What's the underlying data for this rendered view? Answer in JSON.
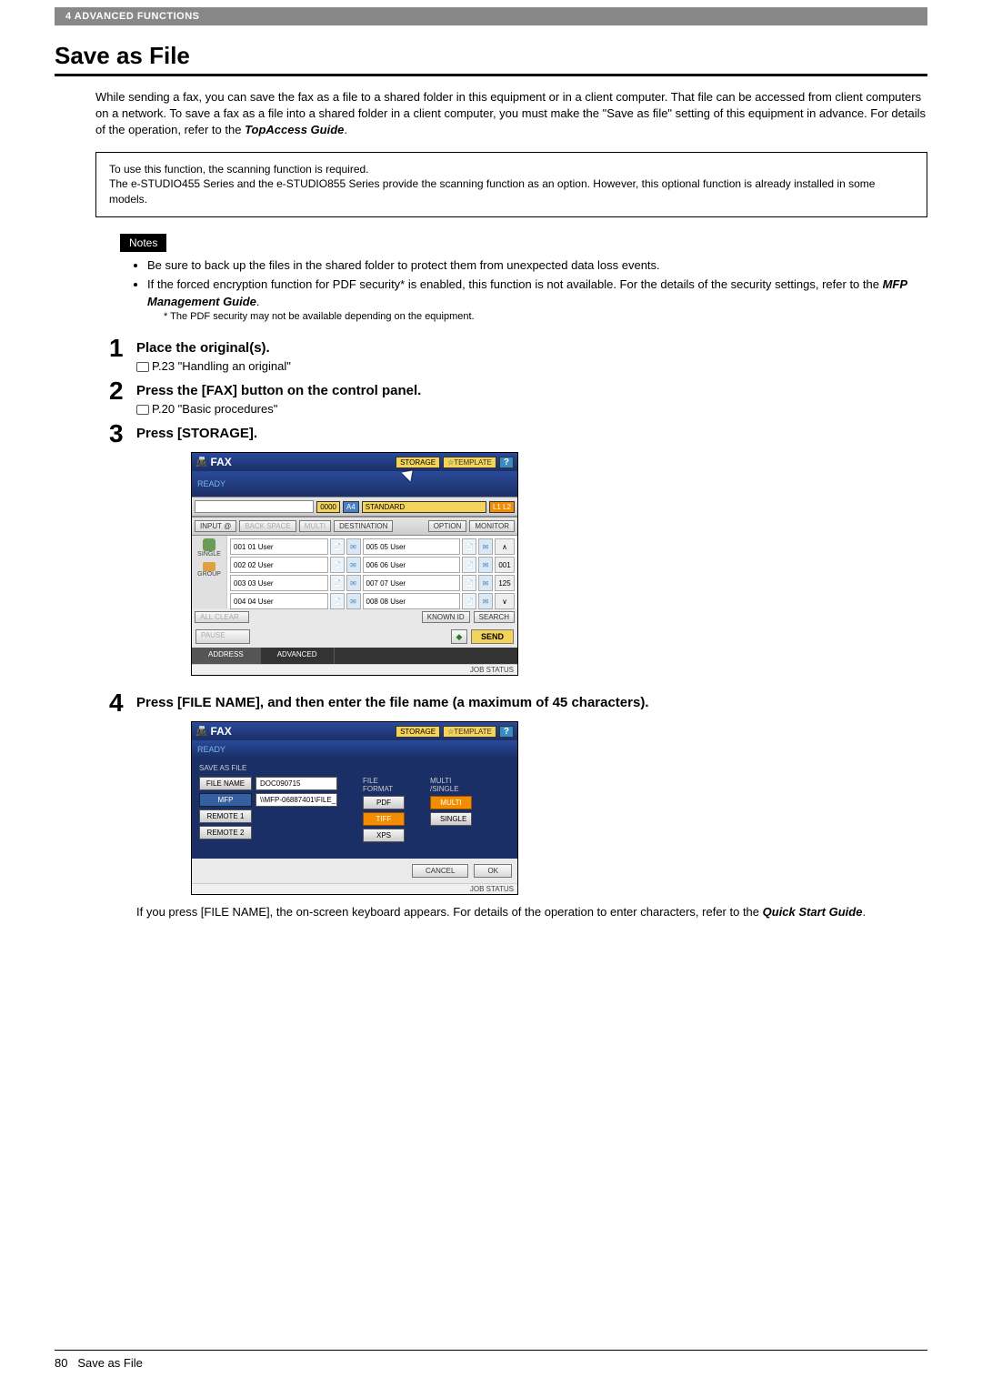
{
  "header": {
    "chapter": "4 ADVANCED FUNCTIONS"
  },
  "title": "Save as File",
  "intro": {
    "text": "While sending a fax, you can save the fax as a file to a shared folder in this equipment or in a client computer. That file can be accessed from client computers on a network. To save a fax as a file into a shared folder in a client computer, you must make the \"Save as file\" setting of this equipment in advance. For details of the operation, refer to the ",
    "ref": "TopAccess Guide",
    "tail": "."
  },
  "info_box": "To use this function, the scanning function is required.\nThe e-STUDIO455 Series and the e-STUDIO855 Series provide the scanning function as an option. However, this optional function is already installed in some models.",
  "notes": {
    "label": "Notes",
    "items": [
      {
        "text": "Be sure to back up the files in the shared folder to protect them from unexpected data loss events."
      },
      {
        "text_a": "If the forced encryption function for PDF security* is enabled, this function is not available. For the details of the security settings, refer to the ",
        "ref": "MFP Management Guide",
        "text_b": ".",
        "foot": "*   The PDF security may not be available depending on the equipment."
      }
    ]
  },
  "steps": [
    {
      "num": "1",
      "title": "Place the original(s).",
      "ref": "P.23 \"Handling an original\""
    },
    {
      "num": "2",
      "title": "Press the [FAX] button on the control panel.",
      "ref": "P.20 \"Basic procedures\""
    },
    {
      "num": "3",
      "title": "Press [STORAGE]."
    },
    {
      "num": "4",
      "title": "Press [FILE NAME], and then enter the file name (a maximum of 45 characters).",
      "note_a": "If you press [FILE NAME], the on-screen keyboard appears. For details of the operation to enter characters, refer to the ",
      "note_ref": "Quick Start Guide",
      "note_b": "."
    }
  ],
  "ss1": {
    "fax": "FAX",
    "storage": "STORAGE",
    "template": "☆TEMPLATE",
    "help": "?",
    "ready": "READY",
    "input": "INPUT @",
    "backspace": "BACK SPACE",
    "multi_btn": "MULTI",
    "destination": "DESTINATION",
    "counter": "0000",
    "size": "A4",
    "standard": "STANDARD",
    "l12": "L1 L2",
    "option": "OPTION",
    "monitor": "MONITOR",
    "single": "SINGLE",
    "group": "GROUP",
    "users_l": [
      "001 01 User",
      "002 02 User",
      "003 03 User",
      "004 04 User"
    ],
    "users_r": [
      "005 05 User",
      "006 06 User",
      "007 07 User",
      "008 08 User"
    ],
    "side_nums": [
      "001",
      "125"
    ],
    "allclear": "ALL CLEAR",
    "knownid": "KNOWN ID",
    "search": "SEARCH",
    "pause": "PAUSE",
    "tab_address": "ADDRESS",
    "tab_advanced": "ADVANCED",
    "send": "SEND",
    "jobstatus": "JOB STATUS"
  },
  "ss2": {
    "fax": "FAX",
    "storage": "STORAGE",
    "template": "☆TEMPLATE",
    "help": "?",
    "ready": "READY",
    "saf": "SAVE AS FILE",
    "filename_label": "FILE NAME",
    "filename_val": "DOC090715",
    "mfp_label": "MFP",
    "mfp_val": "\\\\MFP-06887401\\FILE_",
    "remote1": "REMOTE 1",
    "remote2": "REMOTE 2",
    "fileformat": "FILE\nFORMAT",
    "pdf": "PDF",
    "tiff": "TIFF",
    "xps": "XPS",
    "multisingle": "MULTI\n/SINGLE",
    "multi": "MULTI",
    "single": "SINGLE",
    "cancel": "CANCEL",
    "ok": "OK",
    "jobstatus": "JOB STATUS"
  },
  "footer": {
    "page": "80",
    "title": "Save as File"
  }
}
